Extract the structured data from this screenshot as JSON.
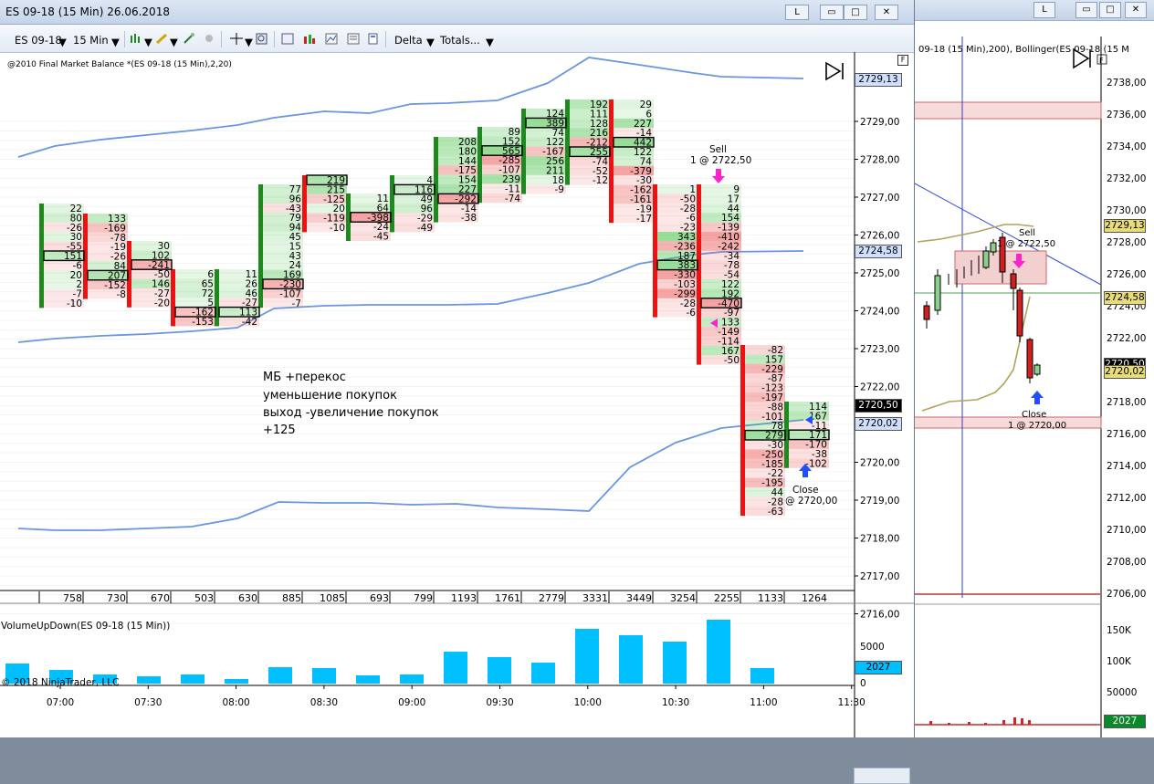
{
  "window": {
    "title": "ES 09-18 (15 Min)  26.06.2018",
    "btn_l": "L",
    "btn_min": "▭",
    "btn_max": "□",
    "btn_close": "✕"
  },
  "toolbar": {
    "instrument": "ES 09-18",
    "interval": "15 Min",
    "delta": "Delta",
    "totals": "Totals..."
  },
  "chart": {
    "label": "@2010 Final Market Balance  *(ES 09-18 (15 Min),2,20)",
    "f_button": "F",
    "copyright": "© 2018 NinjaTrader, LLC",
    "volume_label": "VolumeUpDown(ES 09-18 (15 Min))",
    "price_axis": [
      "2729,00",
      "2728,00",
      "2727,00",
      "2726,00",
      "2725,00",
      "2724,00",
      "2723,00",
      "2722,00",
      "2721,00",
      "2720,00",
      "2719,00",
      "2718,00",
      "2717,00",
      "2716,00"
    ],
    "price_tags": {
      "upper": "2729,13",
      "middle": "2724,58",
      "last": "2720,50",
      "lower": "2720,02"
    },
    "time_axis": [
      "07:00",
      "07:30",
      "08:00",
      "08:30",
      "09:00",
      "09:30",
      "10:00",
      "10:30",
      "11:00",
      "11:30"
    ],
    "volume_axis": [
      "5000",
      "0"
    ],
    "volume_tag": "2027",
    "bar_totals": [
      "758",
      "730",
      "670",
      "503",
      "630",
      "885",
      "1085",
      "693",
      "799",
      "1193",
      "1761",
      "2779",
      "3331",
      "3449",
      "3254",
      "2255",
      "1133",
      "1264"
    ],
    "annotation": [
      "МБ +перекос",
      "уменьшение покупок",
      "выход -увеличение покупок",
      "+125"
    ],
    "sell_label": "Sell",
    "sell_price": "1 @ 2722,50",
    "close_label": "Close",
    "close_price": "@ 2720,00",
    "cells": [
      [
        "22",
        "80",
        "-26",
        "30",
        "-55",
        "151",
        "-6",
        "20",
        "2",
        "-7",
        "-10"
      ],
      [
        "133",
        "-169",
        "-78",
        "-19",
        "-26",
        "84",
        "207",
        "-152",
        "-8"
      ],
      [
        "30",
        "102",
        "-241",
        "-50",
        "146",
        "-27",
        "-20"
      ],
      [
        "6",
        "65",
        "72",
        "5",
        "-162",
        "-153"
      ],
      [
        "11",
        "26",
        "46",
        "-27",
        "113",
        "-42"
      ],
      [
        "77",
        "96",
        "-43",
        "79",
        "94",
        "45",
        "15",
        "43",
        "24",
        "169",
        "-230",
        "-107",
        "-7"
      ],
      [
        "219",
        "215",
        "-125",
        "20",
        "-119",
        "-10"
      ],
      [
        "11",
        "64",
        "-398",
        "-24",
        "-45"
      ],
      [
        "4",
        "116",
        "49",
        "96",
        "-29",
        "-49"
      ],
      [
        "208",
        "180",
        "144",
        "-175",
        "154",
        "227",
        "-292",
        "-14",
        "-38"
      ],
      [
        "89",
        "152",
        "565",
        "-285",
        "-107",
        "239",
        "-11",
        "-74"
      ],
      [
        "124",
        "389",
        "74",
        "122",
        "-167",
        "256",
        "211",
        "18",
        "-9"
      ],
      [
        "192",
        "111",
        "128",
        "216",
        "-212",
        "255",
        "-74",
        "-52",
        "-12"
      ],
      [
        "29",
        "6",
        "227",
        "-14",
        "442",
        "122",
        "74",
        "-379",
        "-30",
        "-162",
        "-161",
        "-19",
        "-17"
      ],
      [
        "1",
        "-50",
        "-28",
        "-6",
        "-23",
        "343",
        "-236",
        "187",
        "383",
        "-330",
        "-103",
        "-299",
        "-28",
        "-6"
      ],
      [
        "9",
        "17",
        "44",
        "154",
        "-139",
        "-410",
        "-242",
        "-34",
        "-78",
        "-54",
        "122",
        "192",
        "-470",
        "-97",
        "133",
        "-149",
        "-114",
        "167",
        "-50"
      ],
      [
        "-82",
        "157",
        "-229",
        "-87",
        "-123",
        "-197",
        "-88",
        "-101",
        "78",
        "279",
        "-30",
        "-250",
        "-185",
        "-22",
        "-195",
        "44",
        "-28",
        "-63"
      ],
      [
        "114",
        "167",
        "-11",
        "171",
        "-170",
        "-38",
        "-102"
      ]
    ]
  },
  "background_window": {
    "caption": "09-18 (15 Min),200), Bollinger(ES 09-18 (15 M",
    "price_axis": [
      "2738,00",
      "2736,00",
      "2734,00",
      "2732,00",
      "2730,00",
      "2728,00",
      "2726,00",
      "2724,00",
      "2722,00",
      "2720,00",
      "2718,00",
      "2716,00",
      "2714,00",
      "2712,00",
      "2710,00",
      "2708,00",
      "2706,00"
    ],
    "price_tags": {
      "upper": "2729,13",
      "middle": "2724,58",
      "last": "2720,50",
      "lower": "2720,02"
    },
    "volume_axis": [
      "150K",
      "100K",
      "50000"
    ],
    "volume_tag": "2027",
    "sell_label": "Sell",
    "sell_price": "1 @ 2722,50",
    "close_label": "Close",
    "close_price": "1 @ 2720,00",
    "btn_l": "L",
    "btn_min": "▭",
    "btn_max": "□",
    "btn_close": "✕",
    "f_button": "F"
  },
  "colors": {
    "accent_blue": "#6a96e0",
    "buy_green": "#1e8a1e",
    "sell_red": "#ee1111",
    "volume_bar": "#00bfff"
  }
}
